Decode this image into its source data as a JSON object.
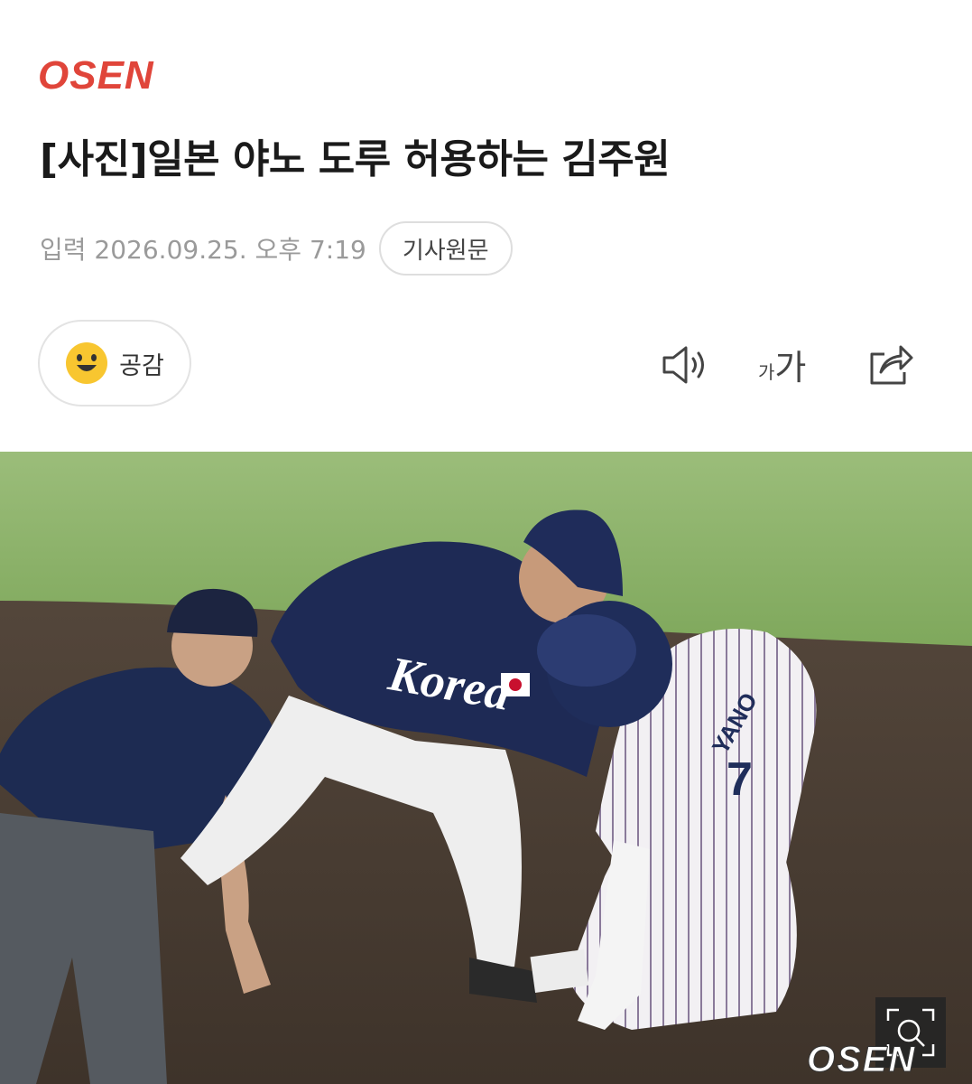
{
  "brand": {
    "logo_text": "OSEN",
    "logo_color": "#e0453a"
  },
  "article": {
    "headline": "[사진]일본 야노 도루 허용하는 김주원",
    "date": "입력 2026.09.25. 오후 7:19",
    "original_label": "기사원문"
  },
  "toolbar": {
    "empathy_label": "공감",
    "empathy_icon": "smile-emoji-icon",
    "fontsize_small": "가",
    "fontsize_large": "가",
    "icons": [
      "speaker-icon",
      "font-size-icon",
      "share-icon"
    ]
  },
  "photo": {
    "jersey_text": "Korea",
    "runner_name": "YANO",
    "runner_number": "7",
    "watermark": "OSEN",
    "zoom_icon": "zoom-icon"
  }
}
